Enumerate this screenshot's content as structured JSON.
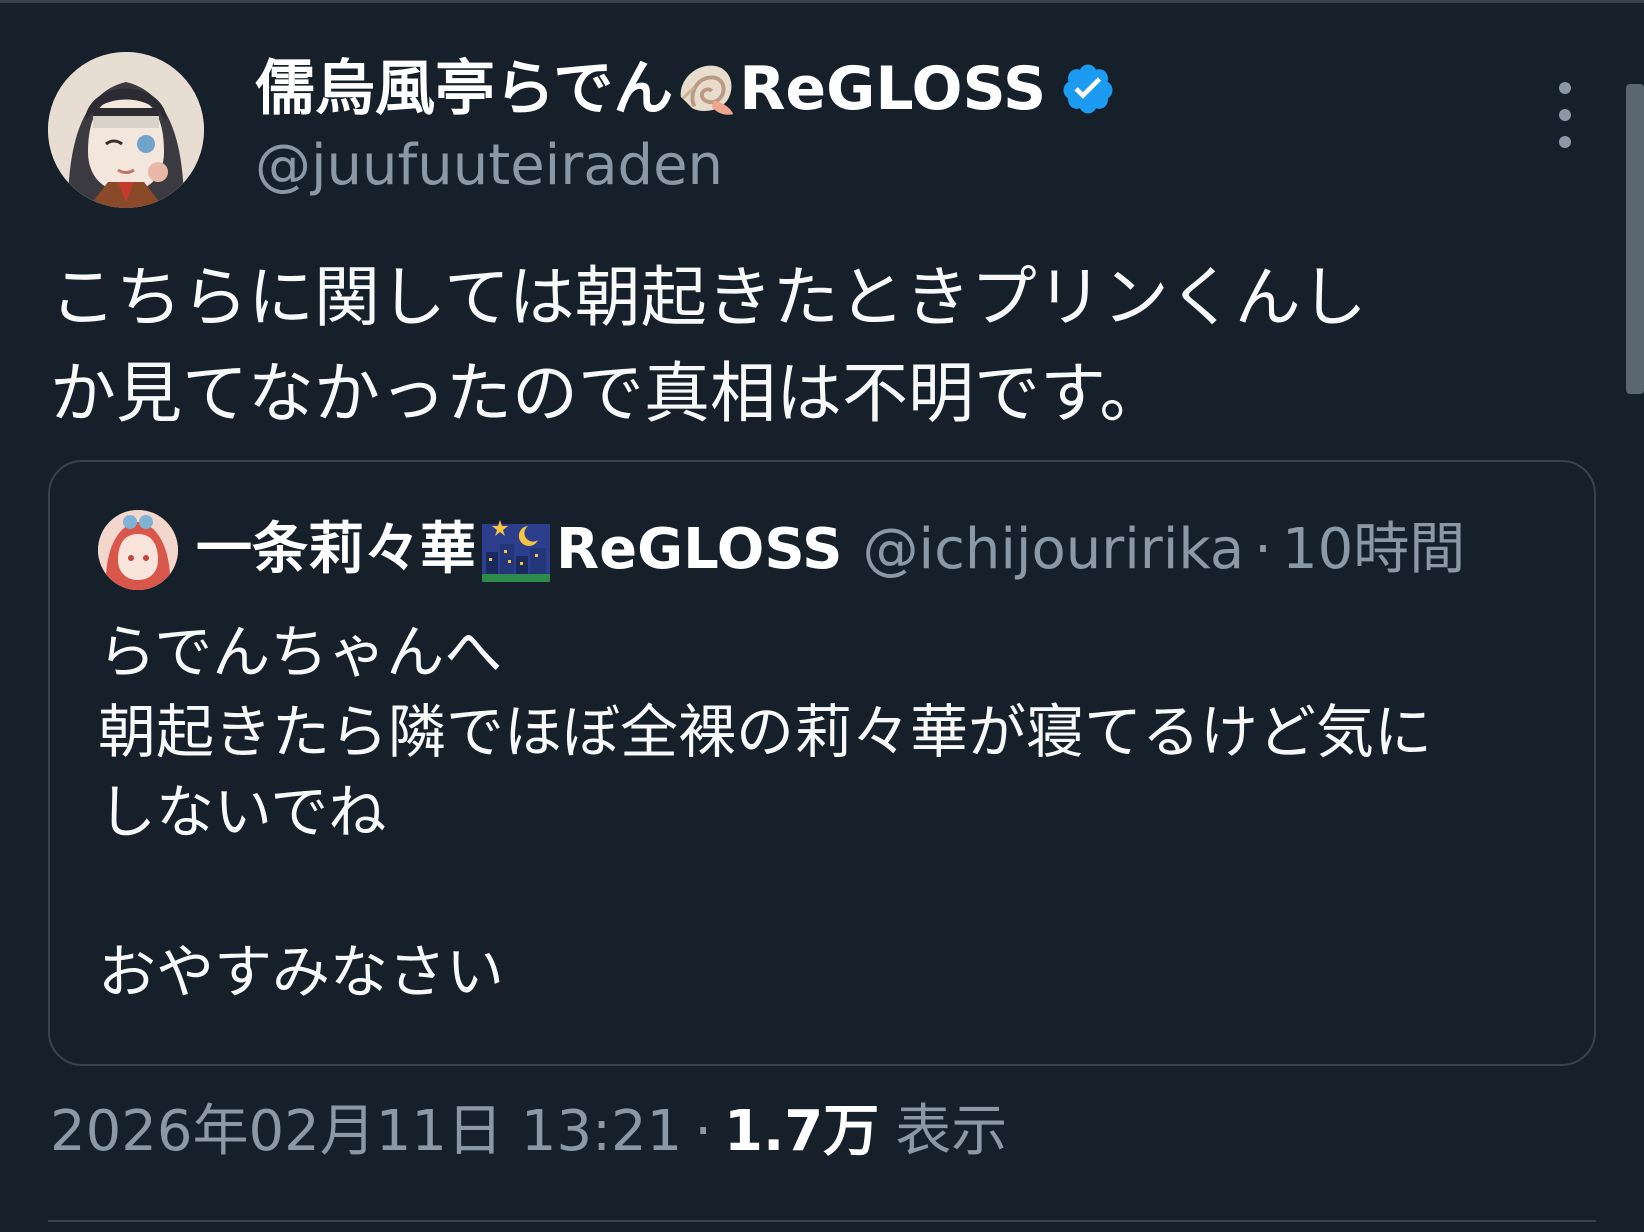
{
  "author": {
    "display_name_main": "儒烏風亭らでん",
    "display_name_suffix": "ReGLOSS",
    "emoji_icon": "spiral-shell-icon",
    "verified_icon": "verified-badge-icon",
    "handle": "@juufuuteiraden"
  },
  "tweet": {
    "text": "こちらに関しては朝起きたときプリンくんし\nか見てなかったので真相は不明です。"
  },
  "quoted_tweet": {
    "display_name_main": "一条莉々華",
    "display_name_suffix": "ReGLOSS",
    "emoji_icon": "night-city-icon",
    "handle": "@ichijouririka",
    "separator": "·",
    "time": "10時間",
    "text": "らでんちゃんへ\n朝起きたら隣でほぼ全裸の莉々華が寝てるけど気に\nしないでね\n\nおやすみなさい"
  },
  "meta": {
    "date": "2026年02月11日 13:21",
    "separator": "·",
    "views": "1.7万",
    "views_label": "表示"
  },
  "colors": {
    "background": "#15202b",
    "muted_text": "#8b98a5",
    "primary_text": "#e7e9ea",
    "border": "#38444d",
    "verified_blue": "#1d9bf0"
  }
}
